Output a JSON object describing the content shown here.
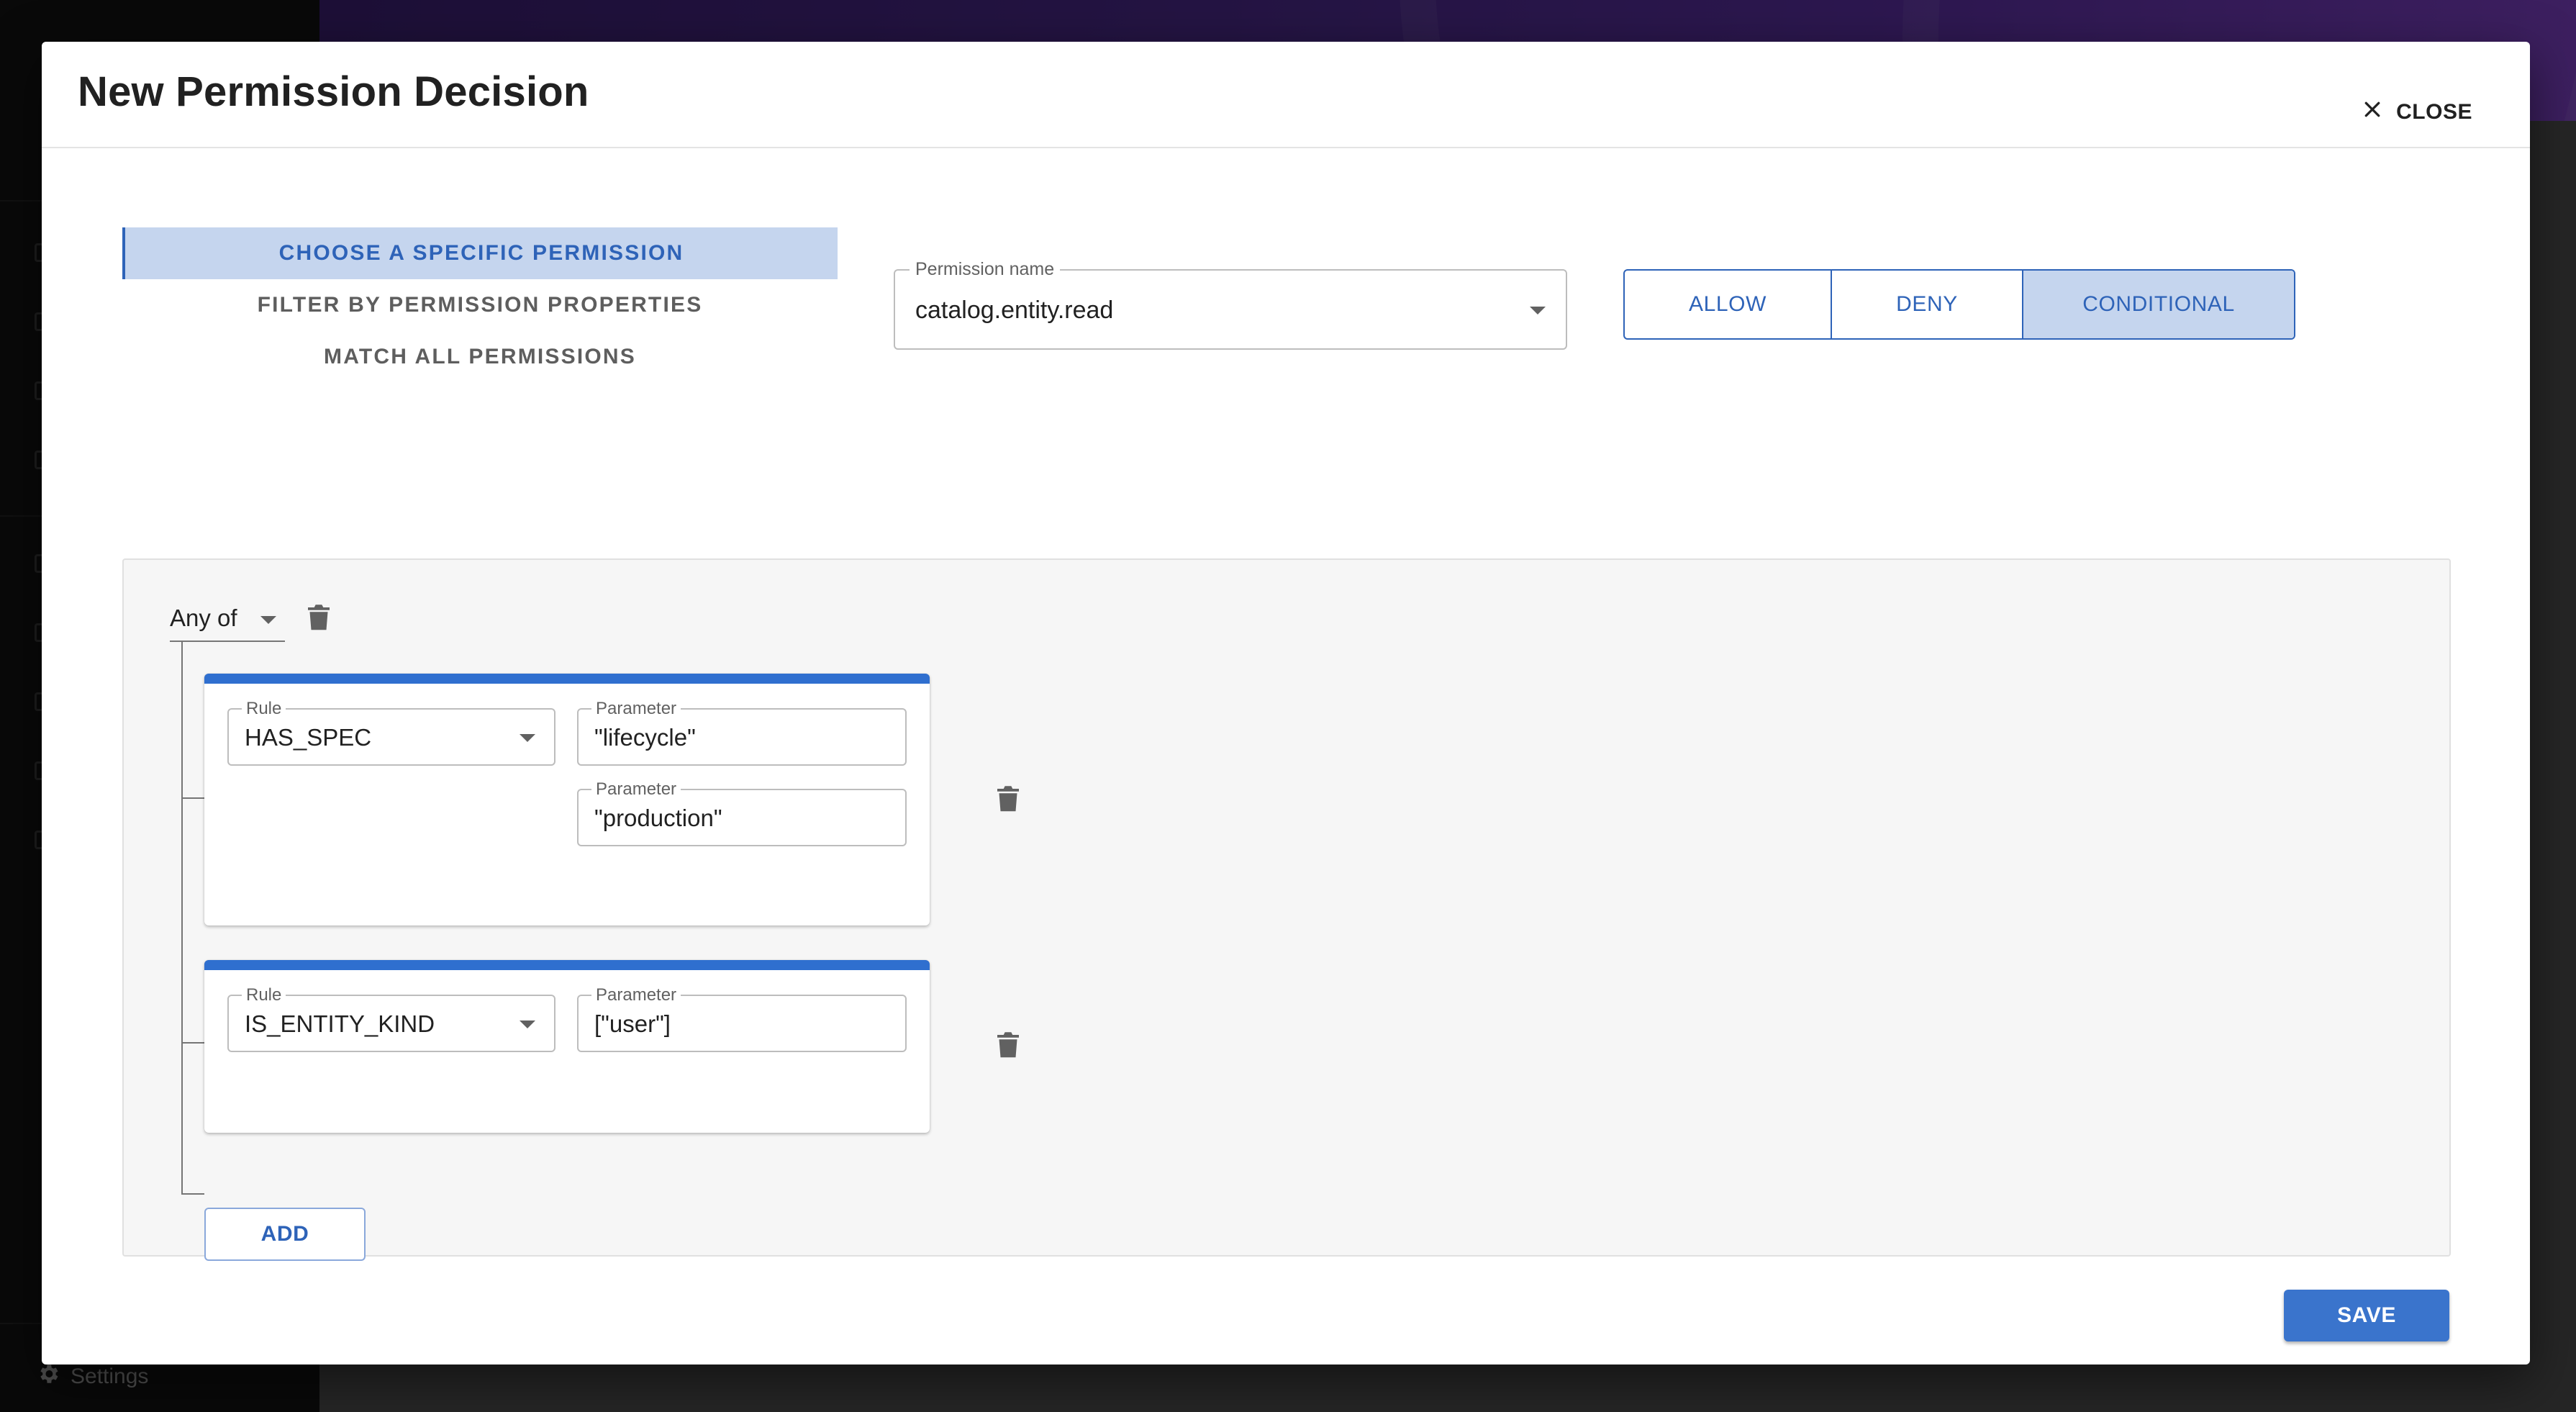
{
  "background": {
    "sidebar_settings_label": "Settings"
  },
  "dialog": {
    "title": "New Permission Decision",
    "close_label": "CLOSE"
  },
  "permission_modes": [
    {
      "label": "CHOOSE A SPECIFIC PERMISSION",
      "selected": true
    },
    {
      "label": "FILTER BY PERMISSION PROPERTIES",
      "selected": false
    },
    {
      "label": "MATCH ALL PERMISSIONS",
      "selected": false
    }
  ],
  "permission_name": {
    "label": "Permission name",
    "value": "catalog.entity.read"
  },
  "decision": {
    "options": [
      "ALLOW",
      "DENY",
      "CONDITIONAL"
    ],
    "selected": "CONDITIONAL"
  },
  "conditions": {
    "operator": "Any of",
    "rules": [
      {
        "rule_label": "Rule",
        "rule": "HAS_SPEC",
        "parameters": [
          {
            "label": "Parameter",
            "value": "\"lifecycle\""
          },
          {
            "label": "Parameter",
            "value": "\"production\""
          }
        ]
      },
      {
        "rule_label": "Rule",
        "rule": "IS_ENTITY_KIND",
        "parameters": [
          {
            "label": "Parameter",
            "value": "[\"user\"]"
          }
        ]
      }
    ],
    "add_label": "ADD"
  },
  "save_label": "SAVE",
  "colors": {
    "primary": "#2e63b8",
    "primary_light": "#c5d5ee",
    "rule_card_accent": "#2f6fcf"
  }
}
